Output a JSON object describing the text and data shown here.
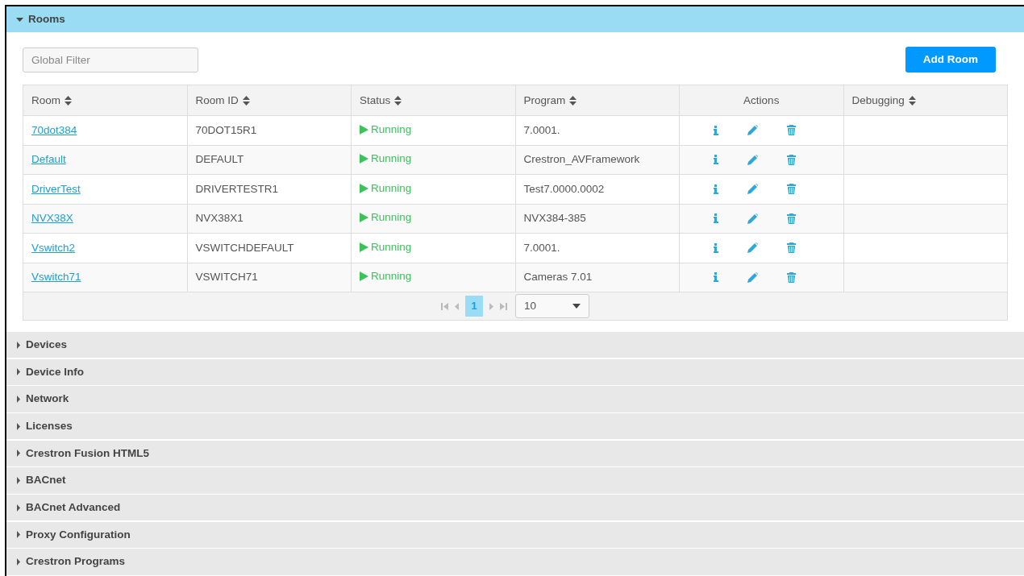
{
  "sections": [
    {
      "title": "Rooms",
      "expanded": true,
      "filter": {
        "placeholder": "Global Filter"
      },
      "add_button": "Add Room",
      "table": {
        "columns": [
          {
            "label": "Room",
            "sortable": true
          },
          {
            "label": "Room ID",
            "sortable": true
          },
          {
            "label": "Status",
            "sortable": true
          },
          {
            "label": "Program",
            "sortable": true
          },
          {
            "label": "Actions",
            "sortable": false
          },
          {
            "label": "Debugging",
            "sortable": true
          }
        ],
        "rows": [
          {
            "room": "70dot384",
            "room_id": "70DOT15R1",
            "status": "Running",
            "program": "7.0001."
          },
          {
            "room": "Default",
            "room_id": "DEFAULT",
            "status": "Running",
            "program": "Crestron_AVFramework"
          },
          {
            "room": "DriverTest",
            "room_id": "DRIVERTESTR1",
            "status": "Running",
            "program": "Test7.0000.0002"
          },
          {
            "room": "NVX38X",
            "room_id": "NVX38X1",
            "status": "Running",
            "program": "NVX384-385"
          },
          {
            "room": "Vswitch2",
            "room_id": "VSWITCHDEFAULT",
            "status": "Running",
            "program": "7.0001."
          },
          {
            "room": "Vswitch71",
            "room_id": "VSWITCH71",
            "status": "Running",
            "program": "Cameras 7.01"
          }
        ],
        "pager": {
          "pages": [
            {
              "label": "1",
              "selected": true
            }
          ],
          "page_size": "10"
        }
      }
    },
    {
      "title": "Devices",
      "expanded": false
    },
    {
      "title": "Device Info",
      "expanded": false
    },
    {
      "title": "Network",
      "expanded": false
    },
    {
      "title": "Licenses",
      "expanded": false
    },
    {
      "title": "Crestron Fusion HTML5",
      "expanded": false
    },
    {
      "title": "BACnet",
      "expanded": false
    },
    {
      "title": "BACnet Advanced",
      "expanded": false
    },
    {
      "title": "Proxy Configuration",
      "expanded": false
    },
    {
      "title": "Crestron Programs",
      "expanded": false
    }
  ]
}
